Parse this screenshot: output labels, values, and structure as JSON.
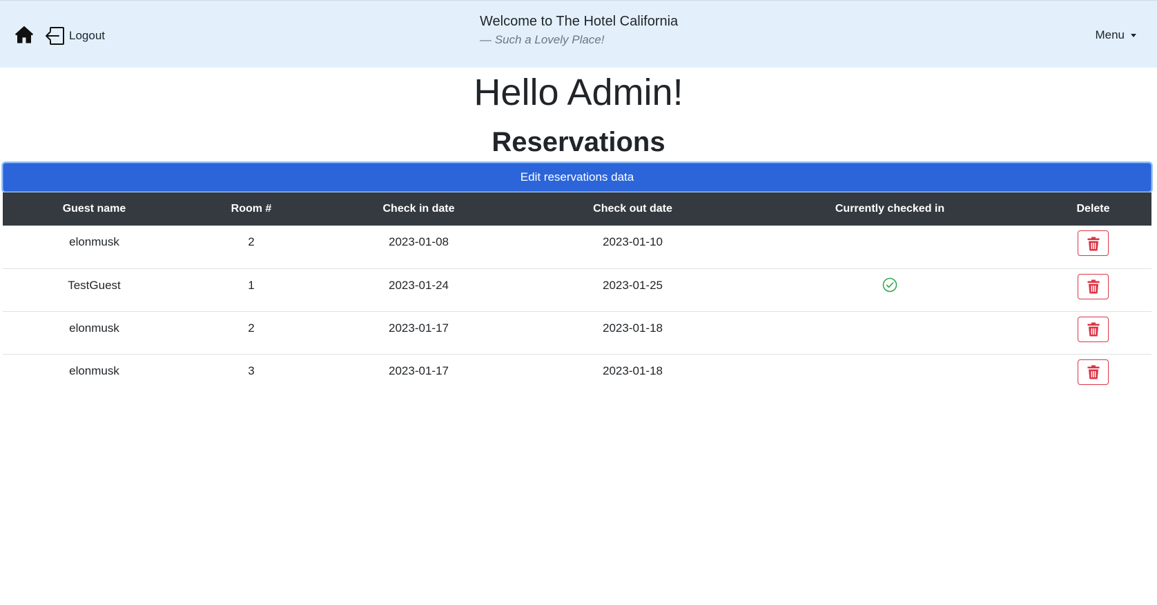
{
  "header": {
    "home_icon": "home-icon",
    "logout_label": "Logout",
    "logout_icon": "logout-icon",
    "title": "Welcome to The Hotel California",
    "subtitle": "— Such a Lovely Place!",
    "menu_label": "Menu"
  },
  "main": {
    "greeting": "Hello Admin!",
    "section_title": "Reservations",
    "edit_button_label": "Edit reservations data"
  },
  "table": {
    "columns": [
      "Guest name",
      "Room #",
      "Check in date",
      "Check out date",
      "Currently checked in",
      "Delete"
    ],
    "rows": [
      {
        "guest": "elonmusk",
        "room": "2",
        "check_in": "2023-01-08",
        "check_out": "2023-01-10",
        "checked_in": false
      },
      {
        "guest": "TestGuest",
        "room": "1",
        "check_in": "2023-01-24",
        "check_out": "2023-01-25",
        "checked_in": true
      },
      {
        "guest": "elonmusk",
        "room": "2",
        "check_in": "2023-01-17",
        "check_out": "2023-01-18",
        "checked_in": false
      },
      {
        "guest": "elonmusk",
        "room": "3",
        "check_in": "2023-01-17",
        "check_out": "2023-01-18",
        "checked_in": false
      }
    ]
  },
  "colors": {
    "navbar_bg": "#e3f0fc",
    "primary": "#2b65d9",
    "table_header_bg": "#343a40",
    "danger": "#dc3545",
    "success": "#28a745"
  }
}
